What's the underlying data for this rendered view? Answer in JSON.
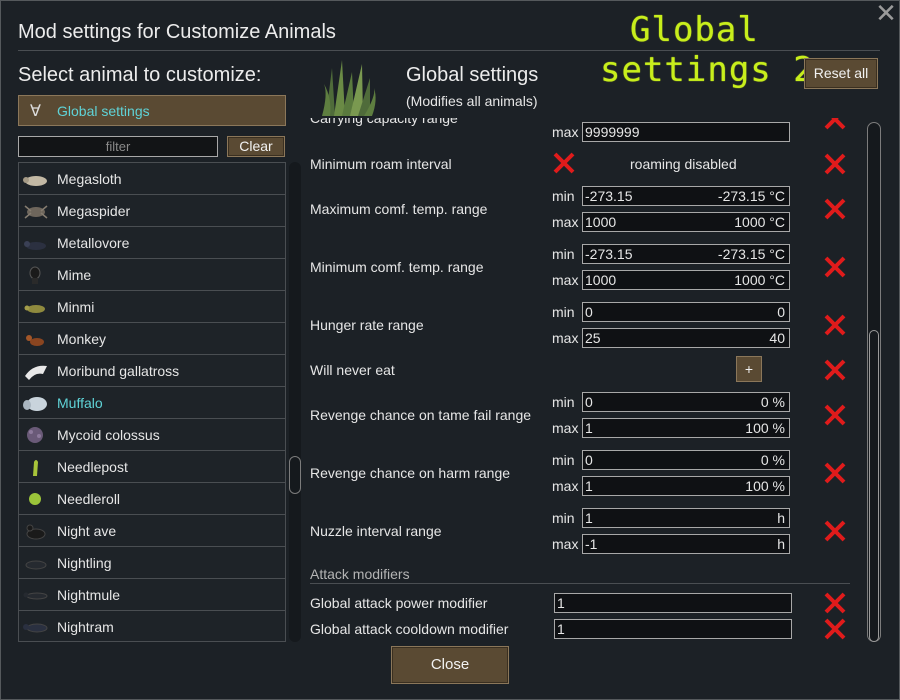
{
  "window": {
    "title": "Mod settings for Customize Animals"
  },
  "overlay": {
    "line1": "Global",
    "line2": "settings 2"
  },
  "left": {
    "heading": "Select animal to customize:",
    "global_item": "Global settings",
    "filter_placeholder": "filter",
    "clear_label": "Clear",
    "animals": [
      {
        "name": "Megasloth"
      },
      {
        "name": "Megaspider"
      },
      {
        "name": "Metallovore"
      },
      {
        "name": "Mime"
      },
      {
        "name": "Minmi"
      },
      {
        "name": "Monkey"
      },
      {
        "name": "Moribund gallatross"
      },
      {
        "name": "Muffalo",
        "selected": true
      },
      {
        "name": "Mycoid colossus"
      },
      {
        "name": "Needlepost"
      },
      {
        "name": "Needleroll"
      },
      {
        "name": "Night ave"
      },
      {
        "name": "Nightling"
      },
      {
        "name": "Nightmule"
      },
      {
        "name": "Nightram"
      }
    ]
  },
  "header": {
    "title": "Global settings",
    "subtitle": "(Modifies all animals)",
    "reset_label": "Reset all"
  },
  "labels": {
    "min": "min",
    "max": "max"
  },
  "settings": {
    "carrying_capacity": {
      "label": "Carrying capacity range",
      "max_value": "9999999"
    },
    "roam": {
      "label": "Minimum roam interval",
      "status": "roaming disabled"
    },
    "max_temp": {
      "label": "Maximum comf. temp. range",
      "min_value": "-273.15",
      "min_display": "-273.15 °C",
      "max_value": "1000",
      "max_display": "1000 °C"
    },
    "min_temp": {
      "label": "Minimum comf. temp. range",
      "min_value": "-273.15",
      "min_display": "-273.15 °C",
      "max_value": "1000",
      "max_display": "1000 °C"
    },
    "hunger": {
      "label": "Hunger rate range",
      "min_value": "0",
      "min_display": "0",
      "max_value": "25",
      "max_display": "40"
    },
    "never_eat": {
      "label": "Will never eat",
      "button": "+"
    },
    "revenge_tame": {
      "label": "Revenge chance on tame fail range",
      "min_value": "0",
      "min_display": "0 %",
      "max_value": "1",
      "max_display": "100 %"
    },
    "revenge_harm": {
      "label": "Revenge chance on harm range",
      "min_value": "0",
      "min_display": "0 %",
      "max_value": "1",
      "max_display": "100 %"
    },
    "nuzzle": {
      "label": "Nuzzle interval range",
      "min_value": "1",
      "min_display": "h",
      "max_value": "-1",
      "max_display": "h"
    },
    "attack_section": "Attack modifiers",
    "attack_power": {
      "label": "Global attack power modifier",
      "value": "1"
    },
    "attack_cooldown": {
      "label": "Global attack cooldown modifier",
      "value": "1"
    }
  },
  "footer": {
    "close_label": "Close"
  },
  "colors": {
    "accent_cyan": "#5fd3d7",
    "button_brown": "#5a4a33",
    "delete_red": "#e01b1b",
    "overlay_green": "#c8ee1c"
  }
}
